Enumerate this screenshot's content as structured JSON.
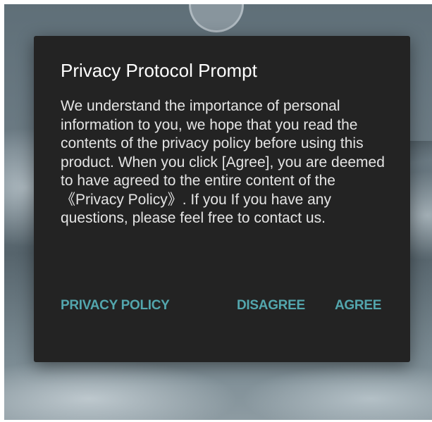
{
  "dialog": {
    "title": "Privacy Protocol Prompt",
    "message": "We understand the importance of personal information to you, we hope that you read the contents of the privacy policy before using this product. When you click [Agree], you are deemed to have agreed to the entire content of the 《Privacy Policy》. If you If you have any questions, please feel free to contact us.",
    "buttons": {
      "privacy_policy": "PRIVACY POLICY",
      "disagree": "DISAGREE",
      "agree": "AGREE"
    }
  },
  "colors": {
    "dialog_background": "#232323",
    "accent": "#53a6ad",
    "title_text": "#ffffff",
    "body_text": "#e4e4e4"
  }
}
